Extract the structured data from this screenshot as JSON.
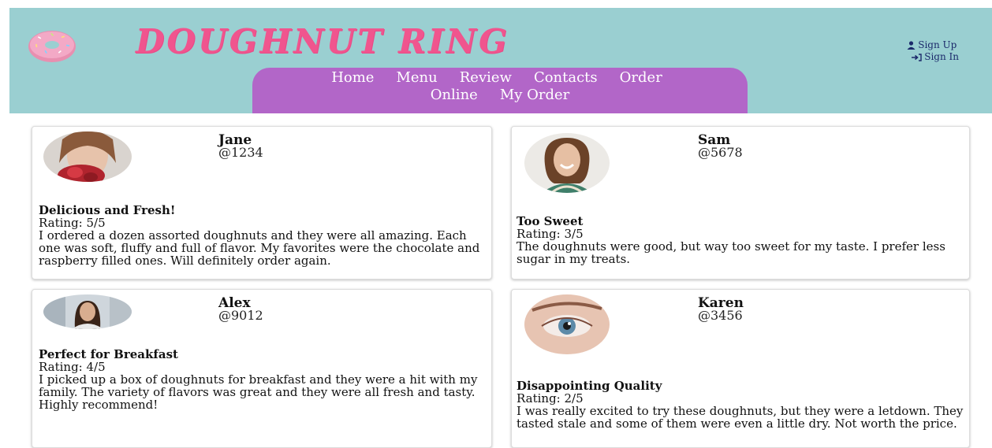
{
  "brand": {
    "name": "DOUGHNUT RING"
  },
  "auth": {
    "sign_up": "Sign Up",
    "sign_in": "Sign In"
  },
  "nav": {
    "items": [
      "Home",
      "Menu",
      "Review",
      "Contacts",
      "Order Online",
      "My Order"
    ],
    "order_part1": "Order",
    "order_part2": "Online"
  },
  "reviews": [
    {
      "name": "Jane",
      "handle": "@1234",
      "title": "Delicious and Fresh!",
      "rating": "Rating: 5/5",
      "text": "I ordered a dozen assorted doughnuts and they were all amazing. Each one was soft, fluffy and full of flavor. My favorites were the chocolate and raspberry filled ones. Will definitely order again."
    },
    {
      "name": "Sam",
      "handle": "@5678",
      "title": "Too Sweet",
      "rating": "Rating: 3/5",
      "text": "The doughnuts were good, but way too sweet for my taste. I prefer less sugar in my treats."
    },
    {
      "name": "Alex",
      "handle": "@9012",
      "title": "Perfect for Breakfast",
      "rating": "Rating: 4/5",
      "text": "I picked up a box of doughnuts for breakfast and they were a hit with my family. The variety of flavors was great and they were all fresh and tasty. Highly recommend!"
    },
    {
      "name": "Karen",
      "handle": "@3456",
      "title": "Disappointing Quality",
      "rating": "Rating: 2/5",
      "text": "I was really excited to try these doughnuts, but they were a letdown. They tasted stale and some of them were even a little dry. Not worth the price."
    }
  ],
  "colors": {
    "header_bg": "#9acfd1",
    "nav_bg": "#b266c8",
    "brand_pink": "#f0558e",
    "auth_link": "#1c2a6b"
  },
  "icons": {
    "logo": "doughnut-logo-icon",
    "sign_up": "user-icon",
    "sign_in": "sign-in-arrow-icon"
  }
}
